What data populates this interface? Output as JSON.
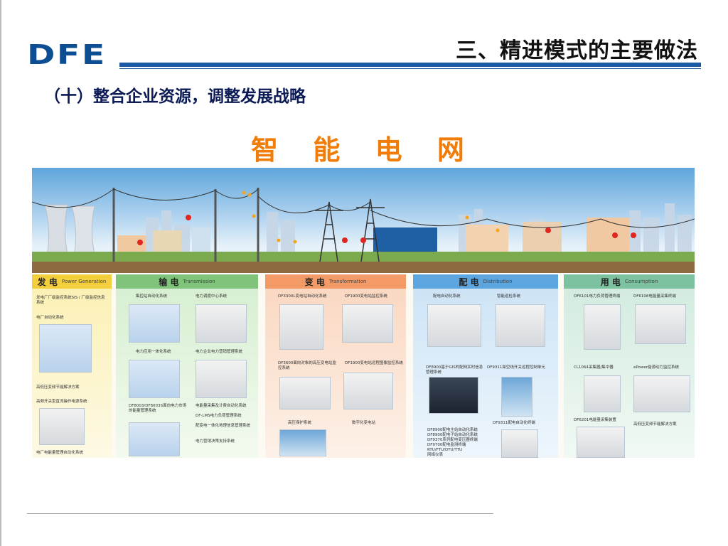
{
  "header": {
    "logo": "DFE",
    "title": "三、精进模式的主要做法",
    "brand_color": "#1a5aa4"
  },
  "subtitle": "（十）整合企业资源，调整发展战略",
  "center_title": "智 能 电 网",
  "accent_color": "#f07d0a",
  "sections": [
    {
      "id": "gen",
      "title_cn": "发 电",
      "title_en": "Power Generation",
      "color": "#f3cf3b",
      "labels": [
        "发电厂厂级监控系统SIS / 厂级监控信息系统",
        "电厂自动化系统",
        "高低压变频节能解决方案",
        "高频开关型直流操作电源系统",
        "电厂电能量管理自动化系统"
      ]
    },
    {
      "id": "trans",
      "title_cn": "输 电",
      "title_en": "Transmission",
      "color": "#7fc47a",
      "labels": [
        "集控站自动化系统",
        "电力调度中心系统",
        "电力应用一体化系统",
        "电力企业电力营销管理系统",
        "DF8003/DF8003S面向电力市场的能量管理系统",
        "电能量采集及计费自动化系统",
        "DF-LMS电力负荷管理系统",
        "配变电一体化地理信息管理系统",
        "电力营销决策支持系统"
      ]
    },
    {
      "id": "sub",
      "title_cn": "变 电",
      "title_en": "Transformation",
      "color": "#f39a66",
      "labels": [
        "DF3300L变电站自动化系统",
        "DF1900变电站监控系统",
        "DF3600面向对象的高压变电站监控系统",
        "DF1900变电站远程图像监控系统",
        "高压保护系统",
        "数字化变电站"
      ]
    },
    {
      "id": "dist",
      "title_cn": "配 电",
      "title_en": "Distribution",
      "color": "#5da5df",
      "labels": [
        "配电自动化系统",
        "智能巡检系统",
        "DF8900基于GIS的配网实时信息管理系统",
        "DF9311架空线开关远程控制单元",
        "DF8900配电主站自动化系统",
        "DF8900配电子站自动化系统",
        "DF9370系列配电变压器终端",
        "DF9700配电监测终端",
        "RTU/FTU/DTU/TTU",
        "网络仪表",
        "DF9311配电自动化终端"
      ]
    },
    {
      "id": "use",
      "title_cn": "用 电",
      "title_en": "Consumption",
      "color": "#7cc2a0",
      "labels": [
        "DF6101电力负荷管理终端",
        "DF6108电能量采集终端",
        "CL1064采集器/集中器",
        "ePower能源动力监控系统",
        "DF6201电能量采集装置",
        "高低压变频节能解决方案"
      ]
    }
  ]
}
